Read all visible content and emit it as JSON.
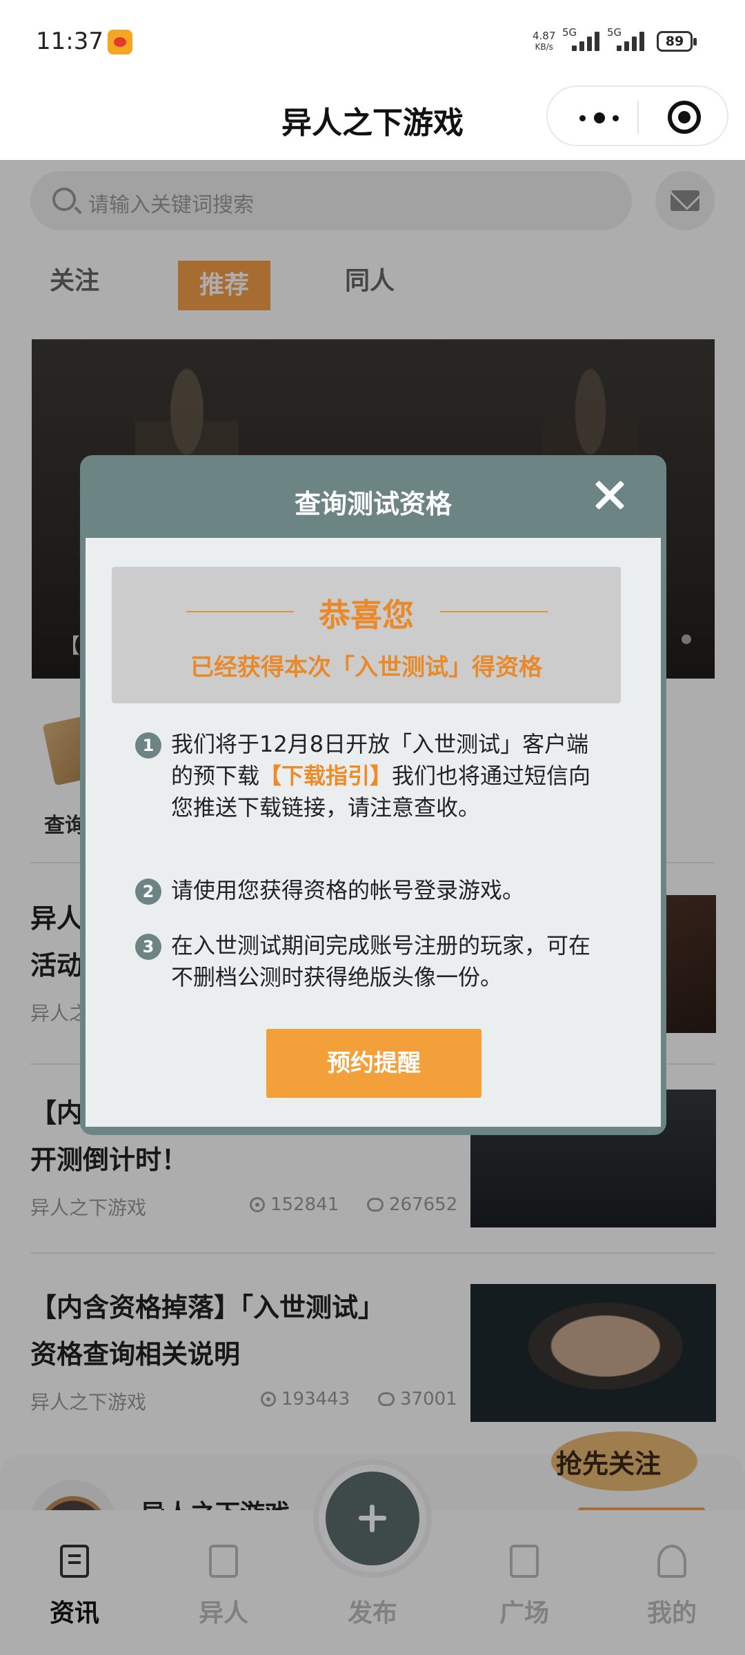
{
  "status_bar": {
    "time": "11:37",
    "speed_top": "4.87",
    "speed_unit": "KB/s",
    "signal1": "5G",
    "signal2": "5G",
    "battery": "89"
  },
  "titlebar": {
    "title": "异人之下游戏"
  },
  "search": {
    "placeholder": "请输入关键词搜索"
  },
  "tabs": [
    "关注",
    "推荐",
    "同人"
  ],
  "banner": {
    "caption": "【"
  },
  "quick_entry": {
    "label": "查询"
  },
  "articles": [
    {
      "title": "异人",
      "title2": "活动",
      "author": "异人之"
    },
    {
      "title": "【内",
      "title2": "开测倒计时！",
      "author": "异人之下游戏",
      "views": "152841",
      "comments": "267652"
    },
    {
      "title": "【内含资格掉落】「入世测试」",
      "title2": "资格查询相关说明",
      "author": "异人之下游戏",
      "views": "193443",
      "comments": "37001"
    }
  ],
  "follow_bar": {
    "name": "异人之下游戏",
    "sticker": "抢先关注"
  },
  "tab_bar": {
    "news": "资讯",
    "yiren": "异人",
    "publish": "发布",
    "square": "广场",
    "mine": "我的"
  },
  "modal": {
    "title": "查询测试资格",
    "congrats": "恭喜您",
    "congrats_sub": "已经获得本次「入世测试」得资格",
    "item1_a": "我们将于12月8日开放「入世测试」客户端的预下载",
    "item1_link": "【下载指引】",
    "item1_b": "我们也将通过短信向您推送下载链接，请注意查收。",
    "item2": "请使用您获得资格的帐号登录游戏。",
    "item3": "在入世测试期间完成账号注册的玩家，可在不删档公测时获得绝版头像一份。",
    "button": "预约提醒",
    "nums": [
      "1",
      "2",
      "3"
    ]
  },
  "colors": {
    "accent": "#f39f3a",
    "modal_header": "#6d8484",
    "highlight": "#f08a26"
  }
}
